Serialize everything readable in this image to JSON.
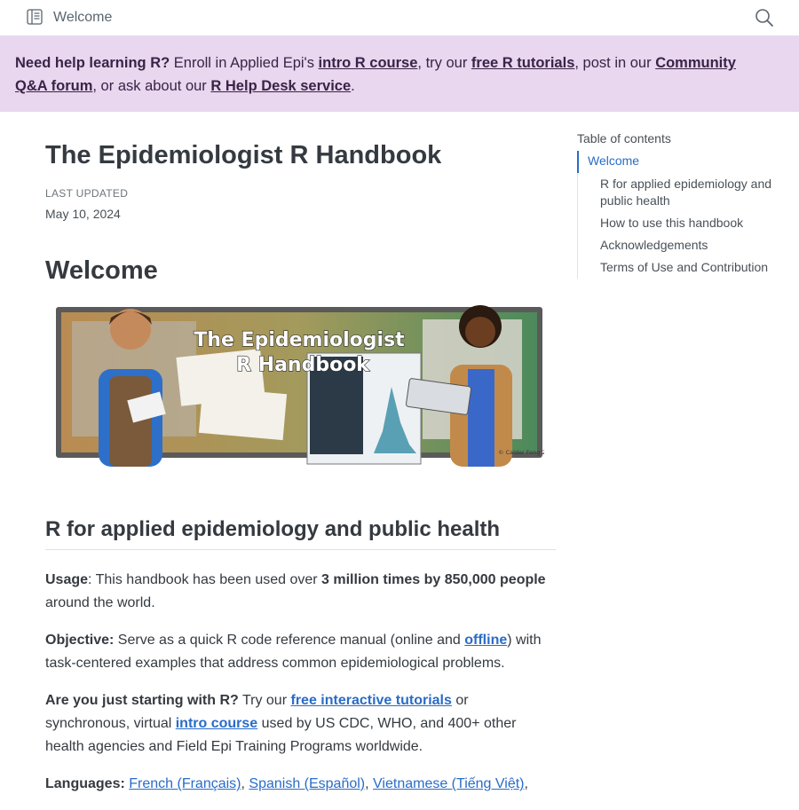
{
  "topbar": {
    "title": "Welcome",
    "sidebar_icon": "sidebar-toggle-icon",
    "search_icon": "search-icon"
  },
  "banner": {
    "lead": "Need help learning R?",
    "text1": " Enroll in Applied Epi's ",
    "link1": "intro R course",
    "text2": ", try our ",
    "link2": "free R tutorials",
    "text3": ", post in our ",
    "link3": "Community Q&A forum",
    "text4": ", or ask about our ",
    "link4": "R Help Desk service",
    "text5": "."
  },
  "page": {
    "title": "The Epidemiologist R Handbook",
    "updated_label": "LAST UPDATED",
    "updated_date": "May 10, 2024",
    "heading": "Welcome"
  },
  "hero": {
    "title_line1": "The Epidemiologist",
    "title_line2": "R Handbook",
    "credit": "© Calder Fong 2021",
    "colors": {
      "frame": "#5a5a5a",
      "board_left": "#b98b52",
      "board_right": "#4c8a5c"
    }
  },
  "section": {
    "heading": "R for applied epidemiology and public health",
    "usage_label": "Usage",
    "usage_text1": ": This handbook has been used over ",
    "usage_bold": "3 million times by 850,000 people",
    "usage_text2": " around the world.",
    "objective_label": "Objective:",
    "objective_text1": " Serve as a quick R code reference manual (online and ",
    "objective_link": "offline",
    "objective_text2": ") with task-centered examples that address common epidemiological problems.",
    "start_label": "Are you just starting with R?",
    "start_text1": " Try our ",
    "start_link1": "free interactive tutorials",
    "start_text2": " or synchronous, virtual ",
    "start_link2": "intro course",
    "start_text3": " used by US CDC, WHO, and 400+ other health agencies and Field Epi Training Programs worldwide.",
    "languages_label": "Languages:",
    "languages": [
      "French (Français)",
      "Spanish (Español)",
      "Vietnamese (Tiếng Việt)"
    ],
    "lang_sep": ", ",
    "lang_trail": ","
  },
  "toc": {
    "title": "Table of contents",
    "items": [
      "Welcome",
      "R for applied epidemiology and public health",
      "How to use this handbook",
      "Acknowledgements",
      "Terms of Use and Contribution"
    ]
  },
  "colors": {
    "banner_bg": "#e8d7ef",
    "link": "#2a6cc7",
    "text": "#343a40"
  }
}
